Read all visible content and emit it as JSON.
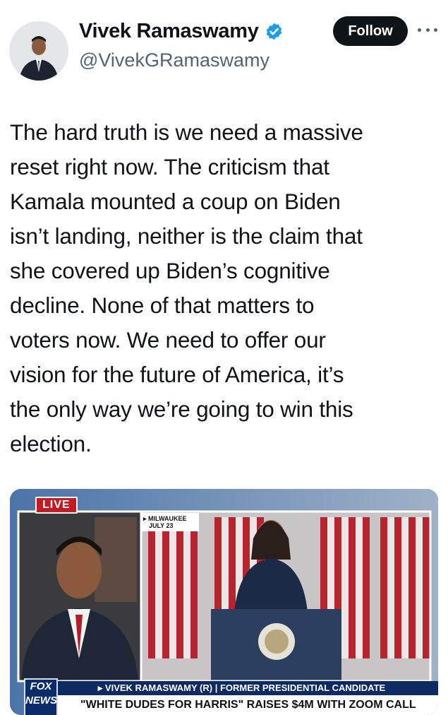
{
  "author": {
    "name": "Vivek Ramaswamy",
    "handle": "@VivekGRamaswamy",
    "verified_icon": "verified-badge-icon",
    "verified_color": "#1d9bf0"
  },
  "actions": {
    "follow_label": "Follow",
    "more_icon": "more-options-icon"
  },
  "tweet": {
    "lines": [
      "The hard truth is we need a massive",
      "reset right now. The criticism that",
      "Kamala mounted a coup on Biden",
      "isn’t landing, neither is the claim that",
      "she covered up Biden’s cognitive",
      "decline. None of that matters to",
      "voters now. We need to offer our",
      "vision for the future of America, it’s",
      "the only way we’re going to win this",
      "election."
    ]
  },
  "media": {
    "live_badge": "LIVE",
    "location_line1": "▸ MILWAUKEE",
    "location_line2": "JULY 23",
    "lower_third": "▸ VIVEK RAMASWAMY (R) | FORMER PRESIDENTIAL CANDIDATE",
    "headline": "\"WHITE DUDES FOR HARRIS\" RAISES $4M WITH ZOOM CALL",
    "network_logo_line1": "FOX",
    "network_logo_line2": "NEWS"
  }
}
